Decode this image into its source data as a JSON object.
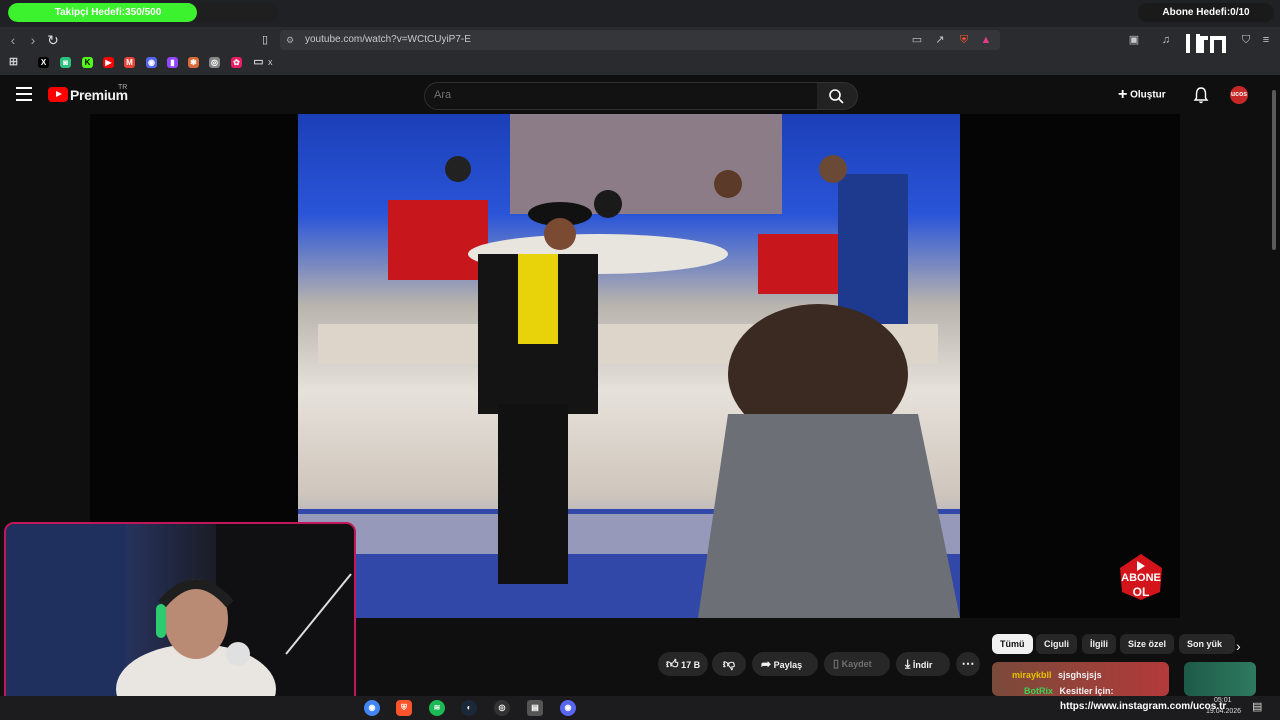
{
  "overlay": {
    "follower_goal": "Takipçi Hedefi:350/500",
    "follower_goal_progress": 0.7,
    "subscriber_goal": "Abone Hedefi:0/10",
    "subscribe_badge_line1": "ABONE",
    "subscribe_badge_line2": "OL",
    "social_url": "https://www.instagram.com/ucos.tr",
    "chat": [
      {
        "user": "miraykbll",
        "message": "sjsghsjsjs"
      },
      {
        "user": "BotRix",
        "message": "Kesitler İçin:"
      }
    ]
  },
  "browser": {
    "url": "youtube.com/watch?v=WCtCUyiP7-E",
    "bookmark_folder_label": "x"
  },
  "youtube": {
    "brand": "Premium",
    "region": "TR",
    "search_placeholder": "Ara",
    "create_label": "Oluştur",
    "like_count": "17 B",
    "share_label": "Paylaş",
    "save_label": "Kaydet",
    "download_label": "İndir",
    "chips": [
      "Tümü",
      "Ciguli",
      "İlgili",
      "Size özel",
      "Son yük"
    ]
  },
  "taskbar": {
    "time": "05:01",
    "date": "19.04.2026"
  },
  "colors": {
    "goal_fill": "#3cf12e",
    "youtube_red": "#ff0000",
    "cam_border": "#c2185b"
  }
}
